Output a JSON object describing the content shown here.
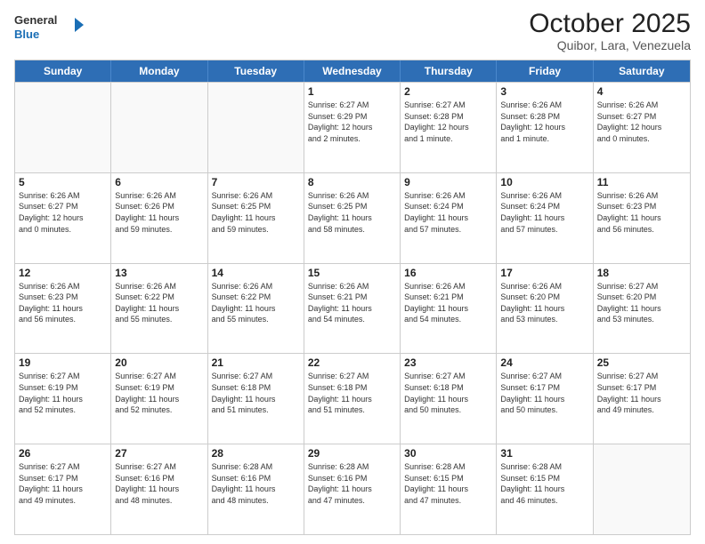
{
  "header": {
    "logo_general": "General",
    "logo_blue": "Blue",
    "title": "October 2025",
    "subtitle": "Quibor, Lara, Venezuela"
  },
  "days_of_week": [
    "Sunday",
    "Monday",
    "Tuesday",
    "Wednesday",
    "Thursday",
    "Friday",
    "Saturday"
  ],
  "weeks": [
    [
      {
        "day": "",
        "info": "",
        "empty": true
      },
      {
        "day": "",
        "info": "",
        "empty": true
      },
      {
        "day": "",
        "info": "",
        "empty": true
      },
      {
        "day": "1",
        "info": "Sunrise: 6:27 AM\nSunset: 6:29 PM\nDaylight: 12 hours\nand 2 minutes."
      },
      {
        "day": "2",
        "info": "Sunrise: 6:27 AM\nSunset: 6:28 PM\nDaylight: 12 hours\nand 1 minute."
      },
      {
        "day": "3",
        "info": "Sunrise: 6:26 AM\nSunset: 6:28 PM\nDaylight: 12 hours\nand 1 minute."
      },
      {
        "day": "4",
        "info": "Sunrise: 6:26 AM\nSunset: 6:27 PM\nDaylight: 12 hours\nand 0 minutes."
      }
    ],
    [
      {
        "day": "5",
        "info": "Sunrise: 6:26 AM\nSunset: 6:27 PM\nDaylight: 12 hours\nand 0 minutes."
      },
      {
        "day": "6",
        "info": "Sunrise: 6:26 AM\nSunset: 6:26 PM\nDaylight: 11 hours\nand 59 minutes."
      },
      {
        "day": "7",
        "info": "Sunrise: 6:26 AM\nSunset: 6:25 PM\nDaylight: 11 hours\nand 59 minutes."
      },
      {
        "day": "8",
        "info": "Sunrise: 6:26 AM\nSunset: 6:25 PM\nDaylight: 11 hours\nand 58 minutes."
      },
      {
        "day": "9",
        "info": "Sunrise: 6:26 AM\nSunset: 6:24 PM\nDaylight: 11 hours\nand 57 minutes."
      },
      {
        "day": "10",
        "info": "Sunrise: 6:26 AM\nSunset: 6:24 PM\nDaylight: 11 hours\nand 57 minutes."
      },
      {
        "day": "11",
        "info": "Sunrise: 6:26 AM\nSunset: 6:23 PM\nDaylight: 11 hours\nand 56 minutes."
      }
    ],
    [
      {
        "day": "12",
        "info": "Sunrise: 6:26 AM\nSunset: 6:23 PM\nDaylight: 11 hours\nand 56 minutes."
      },
      {
        "day": "13",
        "info": "Sunrise: 6:26 AM\nSunset: 6:22 PM\nDaylight: 11 hours\nand 55 minutes."
      },
      {
        "day": "14",
        "info": "Sunrise: 6:26 AM\nSunset: 6:22 PM\nDaylight: 11 hours\nand 55 minutes."
      },
      {
        "day": "15",
        "info": "Sunrise: 6:26 AM\nSunset: 6:21 PM\nDaylight: 11 hours\nand 54 minutes."
      },
      {
        "day": "16",
        "info": "Sunrise: 6:26 AM\nSunset: 6:21 PM\nDaylight: 11 hours\nand 54 minutes."
      },
      {
        "day": "17",
        "info": "Sunrise: 6:26 AM\nSunset: 6:20 PM\nDaylight: 11 hours\nand 53 minutes."
      },
      {
        "day": "18",
        "info": "Sunrise: 6:27 AM\nSunset: 6:20 PM\nDaylight: 11 hours\nand 53 minutes."
      }
    ],
    [
      {
        "day": "19",
        "info": "Sunrise: 6:27 AM\nSunset: 6:19 PM\nDaylight: 11 hours\nand 52 minutes."
      },
      {
        "day": "20",
        "info": "Sunrise: 6:27 AM\nSunset: 6:19 PM\nDaylight: 11 hours\nand 52 minutes."
      },
      {
        "day": "21",
        "info": "Sunrise: 6:27 AM\nSunset: 6:18 PM\nDaylight: 11 hours\nand 51 minutes."
      },
      {
        "day": "22",
        "info": "Sunrise: 6:27 AM\nSunset: 6:18 PM\nDaylight: 11 hours\nand 51 minutes."
      },
      {
        "day": "23",
        "info": "Sunrise: 6:27 AM\nSunset: 6:18 PM\nDaylight: 11 hours\nand 50 minutes."
      },
      {
        "day": "24",
        "info": "Sunrise: 6:27 AM\nSunset: 6:17 PM\nDaylight: 11 hours\nand 50 minutes."
      },
      {
        "day": "25",
        "info": "Sunrise: 6:27 AM\nSunset: 6:17 PM\nDaylight: 11 hours\nand 49 minutes."
      }
    ],
    [
      {
        "day": "26",
        "info": "Sunrise: 6:27 AM\nSunset: 6:17 PM\nDaylight: 11 hours\nand 49 minutes."
      },
      {
        "day": "27",
        "info": "Sunrise: 6:27 AM\nSunset: 6:16 PM\nDaylight: 11 hours\nand 48 minutes."
      },
      {
        "day": "28",
        "info": "Sunrise: 6:28 AM\nSunset: 6:16 PM\nDaylight: 11 hours\nand 48 minutes."
      },
      {
        "day": "29",
        "info": "Sunrise: 6:28 AM\nSunset: 6:16 PM\nDaylight: 11 hours\nand 47 minutes."
      },
      {
        "day": "30",
        "info": "Sunrise: 6:28 AM\nSunset: 6:15 PM\nDaylight: 11 hours\nand 47 minutes."
      },
      {
        "day": "31",
        "info": "Sunrise: 6:28 AM\nSunset: 6:15 PM\nDaylight: 11 hours\nand 46 minutes."
      },
      {
        "day": "",
        "info": "",
        "empty": true
      }
    ]
  ]
}
